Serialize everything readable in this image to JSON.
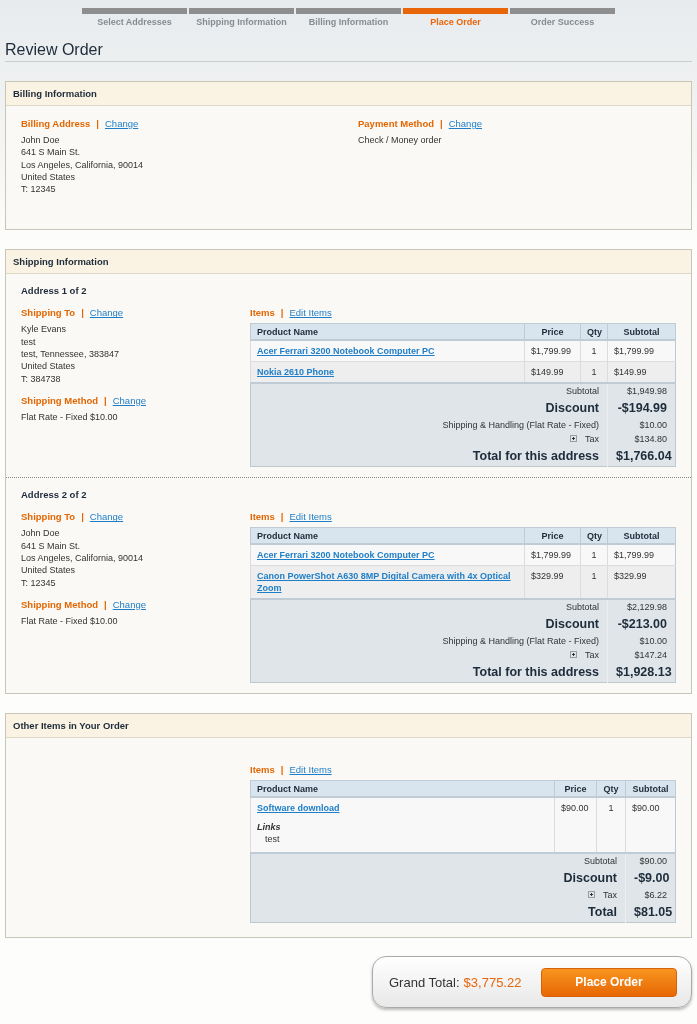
{
  "steps": [
    {
      "label": "Select Addresses",
      "selected": false
    },
    {
      "label": "Shipping Information",
      "selected": false
    },
    {
      "label": "Billing Information",
      "selected": false
    },
    {
      "label": "Place Order",
      "selected": true
    },
    {
      "label": "Order Success",
      "selected": false
    }
  ],
  "page_title": "Review Order",
  "billing": {
    "title": "Billing Information",
    "address": {
      "label": "Billing Address",
      "sep": "|",
      "link": "Change",
      "lines": [
        "John Doe",
        "641 S Main St.",
        "Los Angeles, California, 90014",
        "United States",
        "T: 12345"
      ]
    },
    "payment": {
      "label": "Payment Method",
      "sep": "|",
      "link": "Change",
      "lines": [
        "Check / Money order"
      ]
    }
  },
  "shipping": {
    "title": "Shipping Information",
    "addresses": [
      {
        "heading": "Address 1 of 2",
        "ship_to": {
          "label": "Shipping To",
          "sep": "|",
          "link": "Change",
          "lines": [
            "Kyle Evans",
            "test",
            "test, Tennessee, 383847",
            "United States",
            "T: 384738"
          ]
        },
        "method": {
          "label": "Shipping Method",
          "sep": "|",
          "link": "Change",
          "lines": [
            "Flat Rate - Fixed $10.00"
          ]
        },
        "items": {
          "label": "Items",
          "sep": "|",
          "link": "Edit Items",
          "columns": [
            "Product Name",
            "Price",
            "Qty",
            "Subtotal"
          ],
          "rows": [
            {
              "name": "Acer Ferrari 3200 Notebook Computer PC",
              "price": "$1,799.99",
              "qty": "1",
              "subtotal": "$1,799.99"
            },
            {
              "name": "Nokia 2610 Phone",
              "price": "$149.99",
              "qty": "1",
              "subtotal": "$149.99"
            }
          ],
          "totals": [
            {
              "kind": "normal",
              "label": "Subtotal",
              "value": "$1,949.98"
            },
            {
              "kind": "strong",
              "label": "Discount",
              "value": "-$194.99"
            },
            {
              "kind": "normal",
              "label": "Shipping & Handling (Flat Rate - Fixed)",
              "value": "$10.00"
            },
            {
              "kind": "tax",
              "label": "Tax",
              "value": "$134.80"
            },
            {
              "kind": "strong",
              "label": "Total for this address",
              "value": "$1,766.04"
            }
          ]
        }
      },
      {
        "heading": "Address 2 of 2",
        "ship_to": {
          "label": "Shipping To",
          "sep": "|",
          "link": "Change",
          "lines": [
            "John Doe",
            "641 S Main St.",
            "Los Angeles, California, 90014",
            "United States",
            "T: 12345"
          ]
        },
        "method": {
          "label": "Shipping Method",
          "sep": "|",
          "link": "Change",
          "lines": [
            "Flat Rate - Fixed $10.00"
          ]
        },
        "items": {
          "label": "Items",
          "sep": "|",
          "link": "Edit Items",
          "columns": [
            "Product Name",
            "Price",
            "Qty",
            "Subtotal"
          ],
          "rows": [
            {
              "name": "Acer Ferrari 3200 Notebook Computer PC",
              "price": "$1,799.99",
              "qty": "1",
              "subtotal": "$1,799.99"
            },
            {
              "name": "Canon PowerShot A630 8MP Digital Camera with 4x Optical Zoom",
              "price": "$329.99",
              "qty": "1",
              "subtotal": "$329.99"
            }
          ],
          "totals": [
            {
              "kind": "normal",
              "label": "Subtotal",
              "value": "$2,129.98"
            },
            {
              "kind": "strong",
              "label": "Discount",
              "value": "-$213.00"
            },
            {
              "kind": "normal",
              "label": "Shipping & Handling (Flat Rate - Fixed)",
              "value": "$10.00"
            },
            {
              "kind": "tax",
              "label": "Tax",
              "value": "$147.24"
            },
            {
              "kind": "strong",
              "label": "Total for this address",
              "value": "$1,928.13"
            }
          ]
        }
      }
    ]
  },
  "other": {
    "title": "Other Items in Your Order",
    "items": {
      "label": "Items",
      "sep": "|",
      "link": "Edit Items",
      "columns": [
        "Product Name",
        "Price",
        "Qty",
        "Subtotal"
      ],
      "rows": [
        {
          "name": "Software download",
          "option_label": "Links",
          "option_value": "test",
          "price": "$90.00",
          "qty": "1",
          "subtotal": "$90.00"
        }
      ],
      "totals": [
        {
          "kind": "normal",
          "label": "Subtotal",
          "value": "$90.00"
        },
        {
          "kind": "strong",
          "label": "Discount",
          "value": "-$9.00"
        },
        {
          "kind": "tax",
          "label": "Tax",
          "value": "$6.22"
        },
        {
          "kind": "strong",
          "label": "Total",
          "value": "$81.05"
        }
      ]
    }
  },
  "grand_total": {
    "label": "Grand Total:",
    "value": "$3,775.22",
    "button": "Place Order"
  }
}
